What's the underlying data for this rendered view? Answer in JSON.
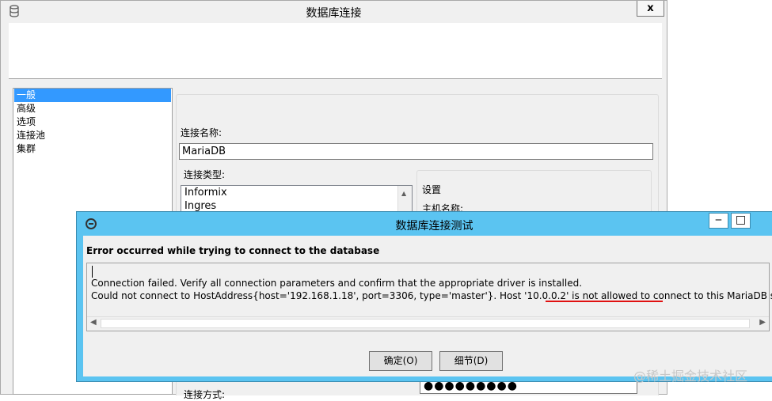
{
  "main_window": {
    "title": "数据库连接",
    "close_label": "x",
    "nav_items": [
      {
        "label": "一般",
        "selected": true
      },
      {
        "label": "高级",
        "selected": false
      },
      {
        "label": "选项",
        "selected": false
      },
      {
        "label": "连接池",
        "selected": false
      },
      {
        "label": "集群",
        "selected": false
      }
    ],
    "connection_name_label": "连接名称:",
    "connection_name_value": "MariaDB",
    "connection_type_label": "连接类型:",
    "connection_types": [
      "Informix",
      "Ingres"
    ],
    "settings_title": "设置",
    "host_name_label": "主机名称:",
    "access_method_label": "连接方式:",
    "password_masked": "●●●●●●●●●"
  },
  "dialog": {
    "title": "数据库连接测试",
    "minimize_label": "‒",
    "maximize_label": "□",
    "heading": "Error occurred while trying to connect to the database",
    "line1": "Connection failed. Verify all connection parameters and confirm that the appropriate driver is installed.",
    "line2": "Could not connect to HostAddress{host='192.168.1.18', port=3306, type='master'}. Host '10.0.0.2' is not allowed to connect to this MariaDB server",
    "ok_label": "确定(O)",
    "details_label": "细节(D)"
  },
  "watermark": "@稀土掘金技术社区",
  "colors": {
    "dialog_frame": "#5bc4f1",
    "selection": "#3399ff",
    "highlight_underline": "#e01010"
  }
}
